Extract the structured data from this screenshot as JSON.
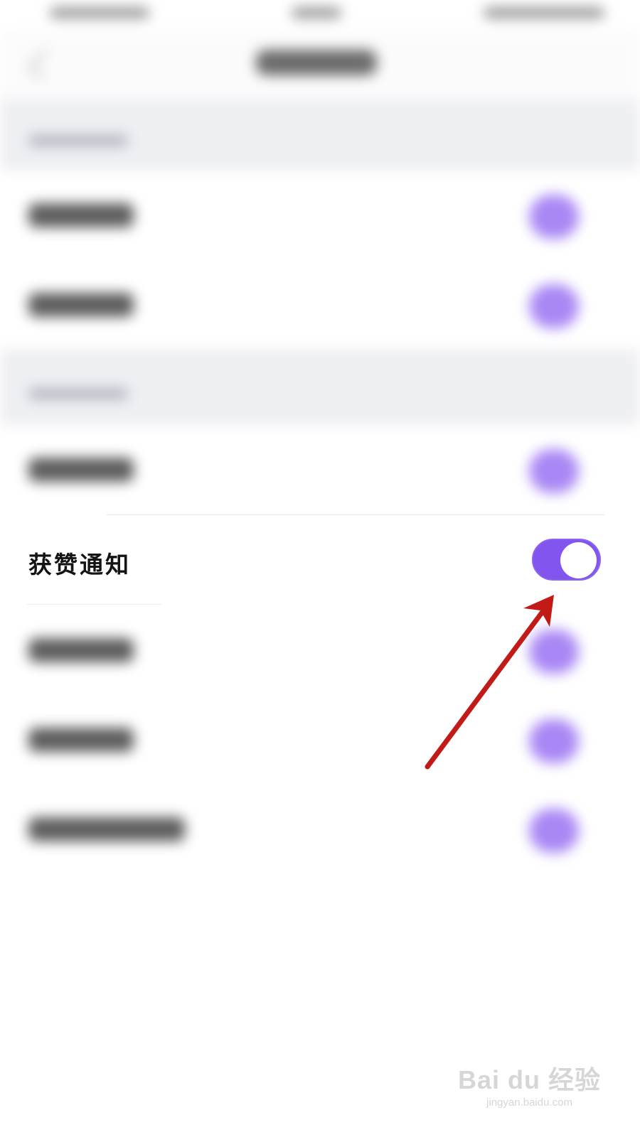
{
  "notification_item": {
    "label": "获赞通知",
    "toggle_on": true
  },
  "colors": {
    "accent": "#8155ee",
    "annotation_arrow": "#c21a16",
    "section_gray": "#eeeff3"
  },
  "watermark": {
    "brand": "Bai du 经验",
    "url": "jingyan.baidu.com"
  }
}
